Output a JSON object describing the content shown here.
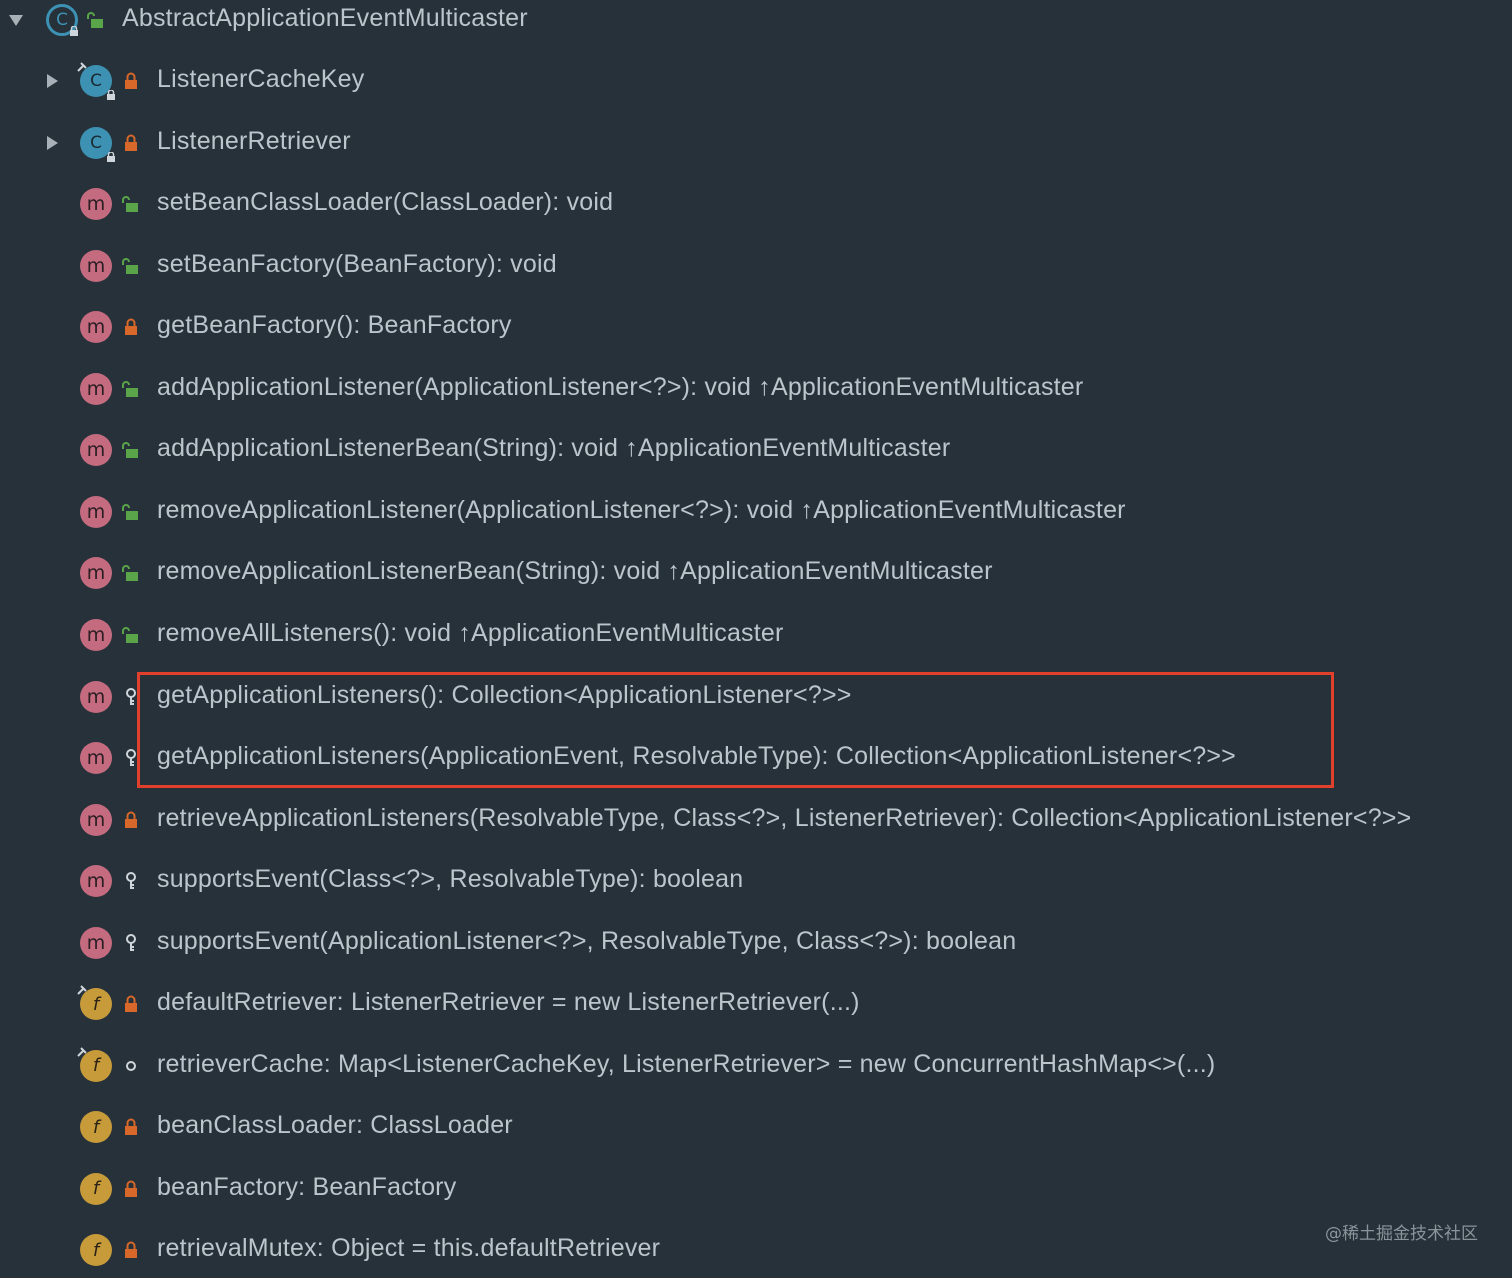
{
  "root": {
    "label": "AbstractApplicationEventMulticaster",
    "expanded": true,
    "icon": "abstract-class-icon",
    "access": "public"
  },
  "members": [
    {
      "label": "ListenerCacheKey",
      "kind": "class",
      "access": "private",
      "expandable": true,
      "static": true
    },
    {
      "label": "ListenerRetriever",
      "kind": "class",
      "access": "private",
      "expandable": true,
      "static": false
    },
    {
      "label": "setBeanClassLoader(ClassLoader): void",
      "kind": "method",
      "access": "public"
    },
    {
      "label": "setBeanFactory(BeanFactory): void",
      "kind": "method",
      "access": "public"
    },
    {
      "label": "getBeanFactory(): BeanFactory",
      "kind": "method",
      "access": "private"
    },
    {
      "label": "addApplicationListener(ApplicationListener<?>): void ↑ApplicationEventMulticaster",
      "kind": "method",
      "access": "public"
    },
    {
      "label": "addApplicationListenerBean(String): void ↑ApplicationEventMulticaster",
      "kind": "method",
      "access": "public"
    },
    {
      "label": "removeApplicationListener(ApplicationListener<?>): void ↑ApplicationEventMulticaster",
      "kind": "method",
      "access": "public"
    },
    {
      "label": "removeApplicationListenerBean(String): void ↑ApplicationEventMulticaster",
      "kind": "method",
      "access": "public"
    },
    {
      "label": "removeAllListeners(): void ↑ApplicationEventMulticaster",
      "kind": "method",
      "access": "public"
    },
    {
      "label": "getApplicationListeners(): Collection<ApplicationListener<?>>",
      "kind": "method",
      "access": "protected"
    },
    {
      "label": "getApplicationListeners(ApplicationEvent, ResolvableType): Collection<ApplicationListener<?>>",
      "kind": "method",
      "access": "protected"
    },
    {
      "label": "retrieveApplicationListeners(ResolvableType, Class<?>, ListenerRetriever): Collection<ApplicationListener<?>>",
      "kind": "method",
      "access": "private"
    },
    {
      "label": "supportsEvent(Class<?>, ResolvableType): boolean",
      "kind": "method",
      "access": "protected"
    },
    {
      "label": "supportsEvent(ApplicationListener<?>, ResolvableType, Class<?>): boolean",
      "kind": "method",
      "access": "protected"
    },
    {
      "label": "defaultRetriever: ListenerRetriever = new ListenerRetriever(...)",
      "kind": "field",
      "access": "private",
      "final": true
    },
    {
      "label": "retrieverCache: Map<ListenerCacheKey, ListenerRetriever> = new ConcurrentHashMap<>(...)",
      "kind": "field",
      "access": "package",
      "final": true
    },
    {
      "label": "beanClassLoader: ClassLoader",
      "kind": "field",
      "access": "private"
    },
    {
      "label": "beanFactory: BeanFactory",
      "kind": "field",
      "access": "private"
    },
    {
      "label": "retrievalMutex: Object = this.defaultRetriever",
      "kind": "field",
      "access": "private"
    }
  ],
  "highlight": {
    "color": "#e0402c",
    "from_index": 10,
    "to_index": 11
  },
  "colors": {
    "background": "#263139",
    "text": "#bcc5cc",
    "public_lock": "#5aa44a",
    "private_lock": "#d8672a",
    "class_icon": "#3d92b4",
    "method_icon": "#c46b80",
    "field_icon": "#c79a3a"
  },
  "watermark": "@稀土掘金技术社区"
}
